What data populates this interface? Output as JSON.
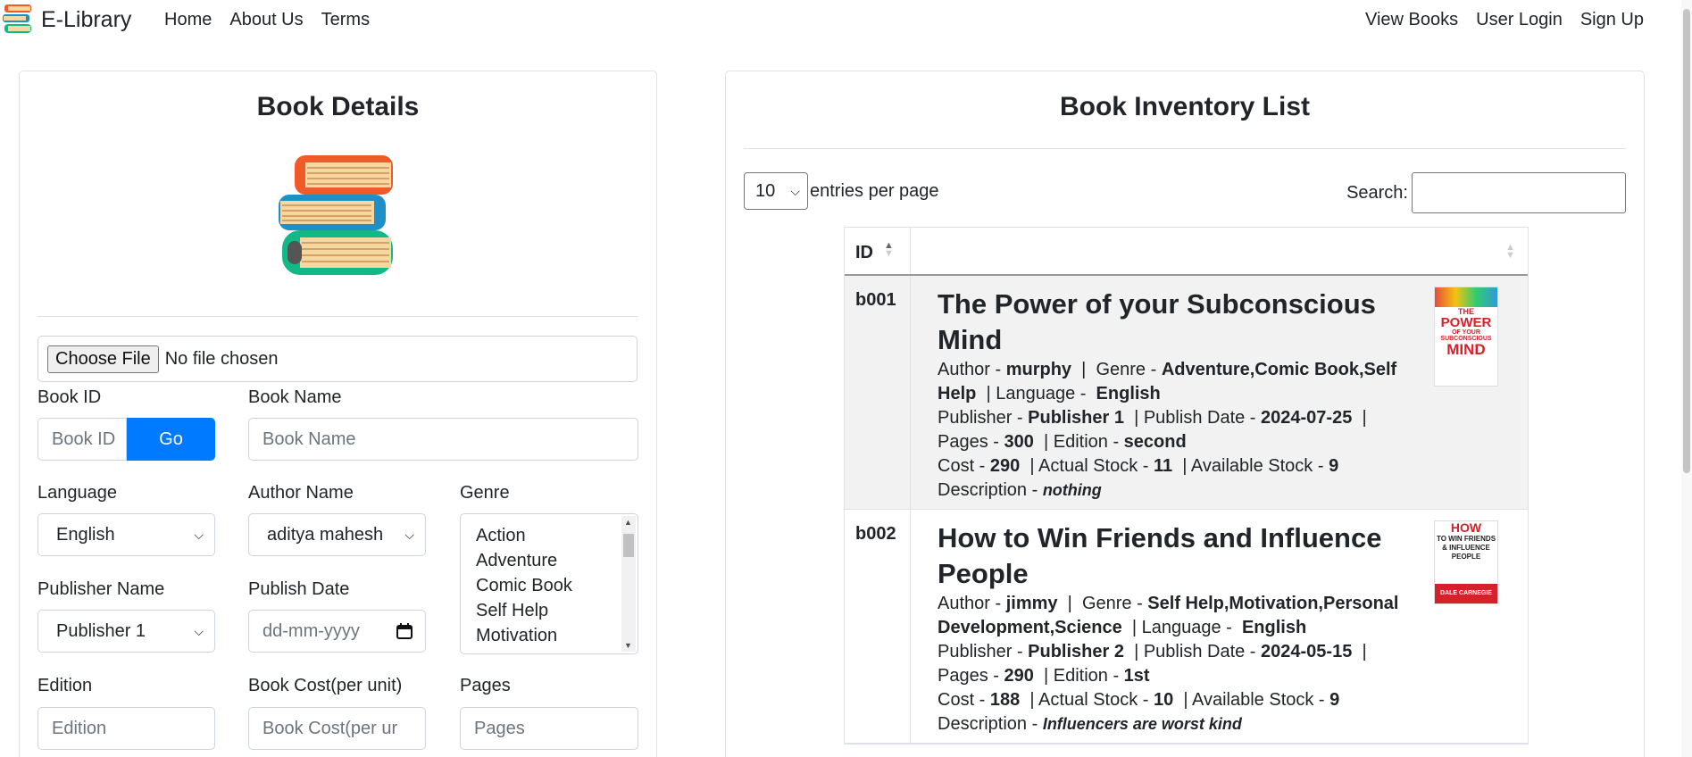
{
  "nav": {
    "brand": "E-Library",
    "left_links": [
      "Home",
      "About Us",
      "Terms"
    ],
    "right_links": [
      "View Books",
      "User Login",
      "Sign Up"
    ]
  },
  "details": {
    "title": "Book Details",
    "file_button": "Choose File",
    "file_status": "No file chosen",
    "book_id_label": "Book ID",
    "book_id_placeholder": "Book ID",
    "go_label": "Go",
    "book_name_label": "Book Name",
    "book_name_placeholder": "Book Name",
    "language_label": "Language",
    "language_value": "English",
    "author_label": "Author Name",
    "author_value": "aditya mahesh",
    "genre_label": "Genre",
    "genres": [
      "Action",
      "Adventure",
      "Comic Book",
      "Self Help",
      "Motivation"
    ],
    "publisher_label": "Publisher Name",
    "publisher_value": "Publisher 1",
    "publish_date_label": "Publish Date",
    "publish_date_placeholder": "dd-mm-yyyy",
    "edition_label": "Edition",
    "edition_placeholder": "Edition",
    "cost_label": "Book Cost(per unit)",
    "cost_placeholder": "Book Cost(per ur",
    "pages_label": "Pages",
    "pages_placeholder": "Pages"
  },
  "inventory": {
    "title": "Book Inventory List",
    "entries_value": "10",
    "entries_text": "entries per page",
    "search_label": "Search:",
    "col_id": "ID",
    "labels": {
      "author": "Author - ",
      "genre": "Genre - ",
      "language": "Language - ",
      "publisher": "Publisher - ",
      "publish_date": "Publish Date - ",
      "pages": "Pages - ",
      "edition": "Edition - ",
      "cost": "Cost - ",
      "actual_stock": "Actual Stock - ",
      "available_stock": "Available Stock - ",
      "description": "Description - "
    },
    "books": [
      {
        "id": "b001",
        "title": "The Power of your Subconscious Mind",
        "author": "murphy",
        "genre": "Adventure,Comic Book,Self Help",
        "language": "English",
        "publisher": "Publisher 1",
        "publish_date": "2024-07-25",
        "pages": "300",
        "edition": "second",
        "cost": "290",
        "actual_stock": "11",
        "available_stock": "9",
        "description": "nothing",
        "cover_top": "THE",
        "cover_main": "POWER",
        "cover_sub": "OF YOUR SUBCONSCIOUS",
        "cover_bottom": "MIND"
      },
      {
        "id": "b002",
        "title": "How to Win Friends and Influence People",
        "author": "jimmy",
        "genre": "Self Help,Motivation,Personal Development,Science",
        "language": "English",
        "publisher": "Publisher 2",
        "publish_date": "2024-05-15",
        "pages": "290",
        "edition": "1st",
        "cost": "188",
        "actual_stock": "10",
        "available_stock": "9",
        "description": "Influencers are worst kind",
        "cover_top": "HOW",
        "cover_main": "TO WIN FRIENDS & INFLUENCE PEOPLE",
        "cover_bottom": "DALE CARNEGIE"
      }
    ]
  },
  "colors": {
    "primary": "#007bff",
    "border": "#dee2e6",
    "row_shade": "#f2f2f2",
    "text": "#212529"
  },
  "icons": [
    "books-logo-icon",
    "chevron-down-icon",
    "calendar-icon",
    "sort-icon"
  ]
}
